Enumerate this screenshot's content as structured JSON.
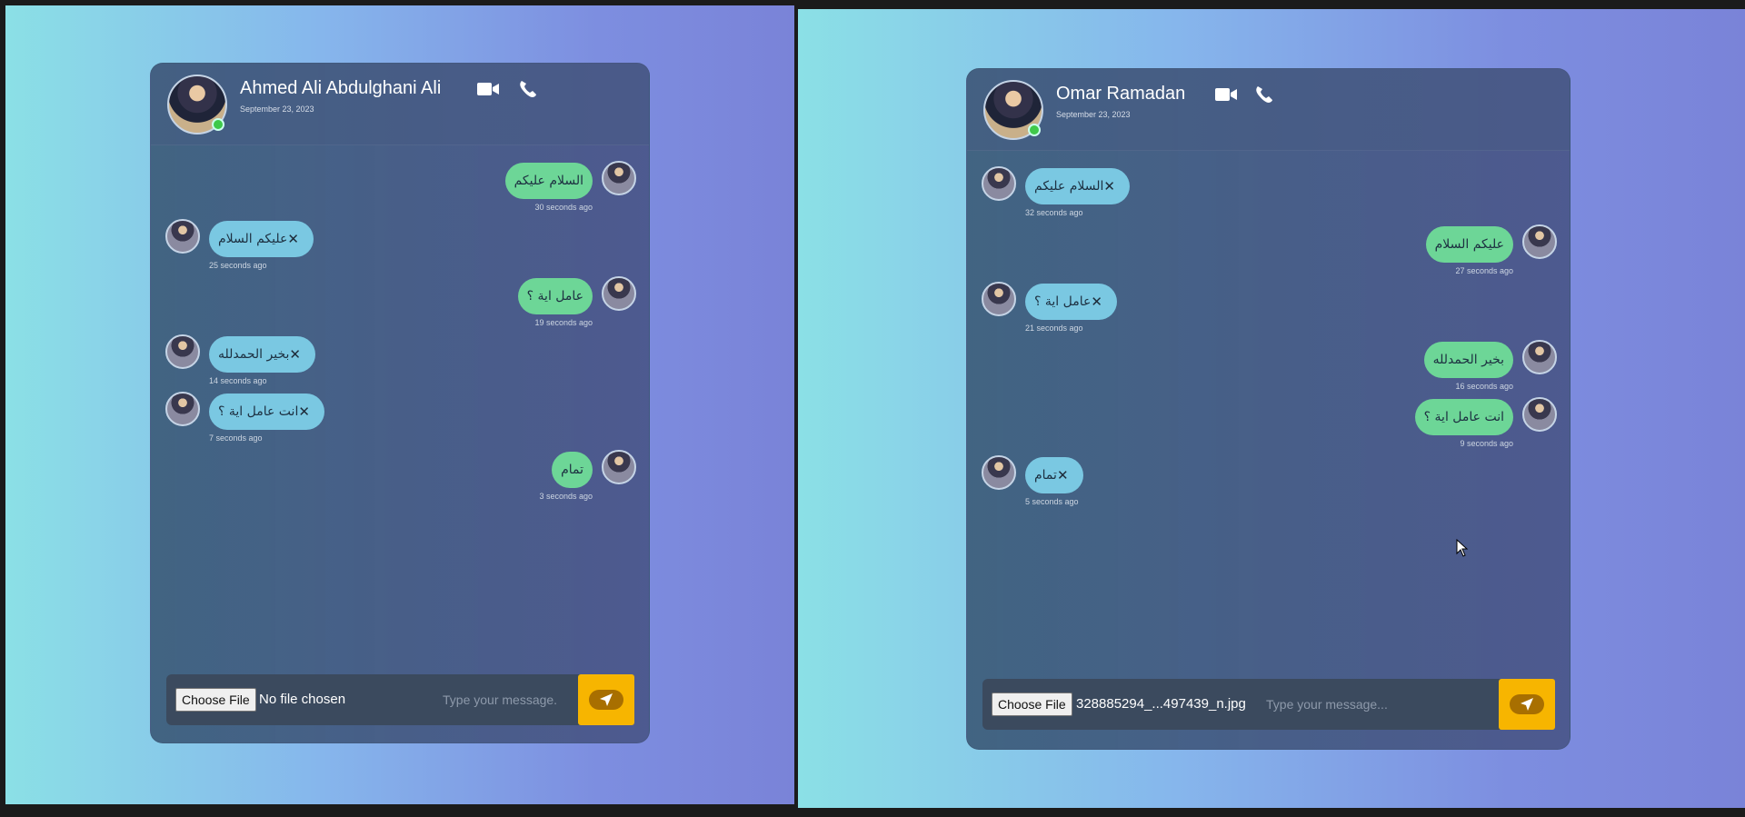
{
  "left_chat": {
    "contact": {
      "name": "Ahmed Ali Abdulghani Ali",
      "date": "September 23, 2023"
    },
    "icons": {
      "video": "video-camera-icon",
      "phone": "phone-icon"
    },
    "messages": [
      {
        "side": "sent",
        "text": "السلام عليكم",
        "time": "30 seconds ago"
      },
      {
        "side": "recv",
        "text": "عليكم السلام",
        "time": "25 seconds ago"
      },
      {
        "side": "sent",
        "text": "عامل اية ؟",
        "time": "19 seconds ago"
      },
      {
        "side": "recv",
        "text": "بخير الحمدلله",
        "time": "14 seconds ago"
      },
      {
        "side": "recv",
        "text": "انت عامل اية ؟",
        "time": "7 seconds ago"
      },
      {
        "side": "sent",
        "text": "تمام",
        "time": "3 seconds ago"
      }
    ],
    "composer": {
      "file_button": "Choose File",
      "file_status": "No file chosen",
      "placeholder": "Type your message."
    }
  },
  "right_chat": {
    "contact": {
      "name": "Omar Ramadan",
      "date": "September 23, 2023"
    },
    "icons": {
      "video": "video-camera-icon",
      "phone": "phone-icon"
    },
    "messages": [
      {
        "side": "recv",
        "text": "السلام عليكم",
        "time": "32 seconds ago"
      },
      {
        "side": "sent",
        "text": "عليكم السلام",
        "time": "27 seconds ago"
      },
      {
        "side": "recv",
        "text": "عامل اية ؟",
        "time": "21 seconds ago"
      },
      {
        "side": "sent",
        "text": "بخير الحمدلله",
        "time": "16 seconds ago"
      },
      {
        "side": "sent",
        "text": "انت عامل اية ؟",
        "time": "9 seconds ago"
      },
      {
        "side": "recv",
        "text": "تمام",
        "time": "5 seconds ago"
      }
    ],
    "composer": {
      "file_button": "Choose File",
      "file_status": "328885294_...497439_n.jpg",
      "placeholder": "Type your message..."
    }
  },
  "colors": {
    "sent_bubble": "#6dd697",
    "recv_bubble": "#7ac8e2",
    "send_button": "#f7b500",
    "online": "#3fc94a"
  }
}
